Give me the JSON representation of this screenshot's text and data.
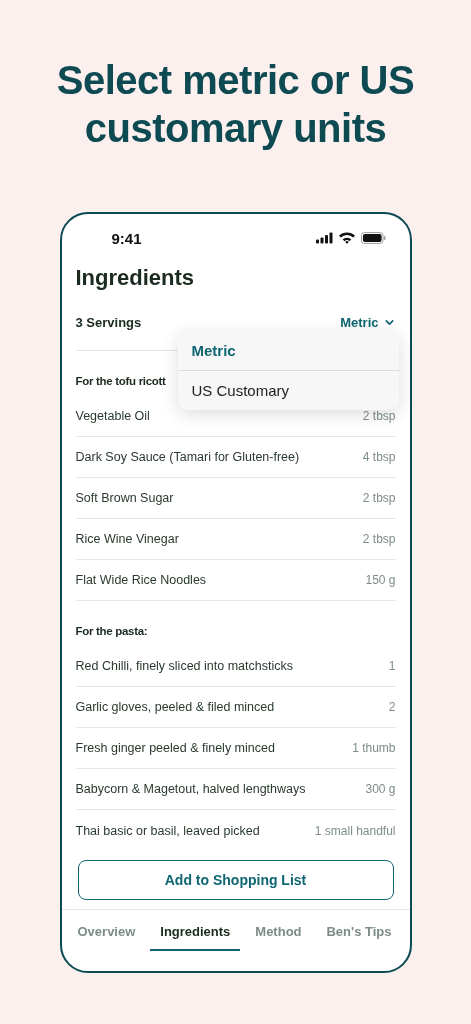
{
  "headline": "Select metric or US customary units",
  "status_bar": {
    "time": "9:41"
  },
  "title": "Ingredients",
  "servings": "3 Servings",
  "unit_selector": {
    "value": "Metric",
    "expanded": true
  },
  "unit_menu": [
    {
      "label": "Metric",
      "selected": true
    },
    {
      "label": "US Customary",
      "selected": false
    }
  ],
  "sections": [
    {
      "heading": "For the tofu ricott",
      "items": [
        {
          "name": "Vegetable Oil",
          "amount": "2 tbsp"
        },
        {
          "name": "Dark Soy Sauce (Tamari for Gluten-free)",
          "amount": "4 tbsp"
        },
        {
          "name": "Soft Brown Sugar",
          "amount": "2 tbsp"
        },
        {
          "name": "Rice Wine Vinegar",
          "amount": "2 tbsp"
        },
        {
          "name": "Flat Wide Rice Noodles",
          "amount": "150 g"
        }
      ]
    },
    {
      "heading": "For the pasta:",
      "items": [
        {
          "name": "Red Chilli, finely sliced into matchsticks",
          "amount": "1"
        },
        {
          "name": "Garlic gloves, peeled & filed minced",
          "amount": "2"
        },
        {
          "name": "Fresh ginger peeled & finely minced",
          "amount": "1 thumb"
        },
        {
          "name": "Babycorn & Magetout, halved lengthways",
          "amount": "300 g"
        },
        {
          "name": "Thai basic or basil, leaved picked",
          "amount": "1 small handful"
        }
      ]
    }
  ],
  "add_button": "Add to Shopping List",
  "tabs": [
    {
      "label": "Overview",
      "selected": false
    },
    {
      "label": "Ingredients",
      "selected": true
    },
    {
      "label": "Method",
      "selected": false
    },
    {
      "label": "Ben's Tips",
      "selected": false
    }
  ]
}
